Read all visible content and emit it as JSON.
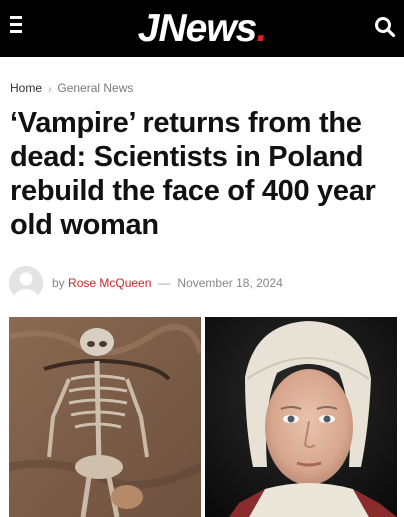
{
  "header": {
    "logo_main": "JNews",
    "logo_dot": ".",
    "brand_color": "#e0201b",
    "menu_icon": "hamburger-menu-icon",
    "search_icon": "search-icon"
  },
  "breadcrumb": {
    "home": "Home",
    "separator": "›",
    "category": "General News"
  },
  "article": {
    "title": "‘Vampire’ returns from the dead: Scientists in Poland rebuild the face of 400 year old woman",
    "by_label": "by",
    "author": "Rose McQueen",
    "dash": "—",
    "date": "November 18, 2024"
  },
  "colors": {
    "author_link": "#c62828",
    "header_bg": "#000000"
  }
}
